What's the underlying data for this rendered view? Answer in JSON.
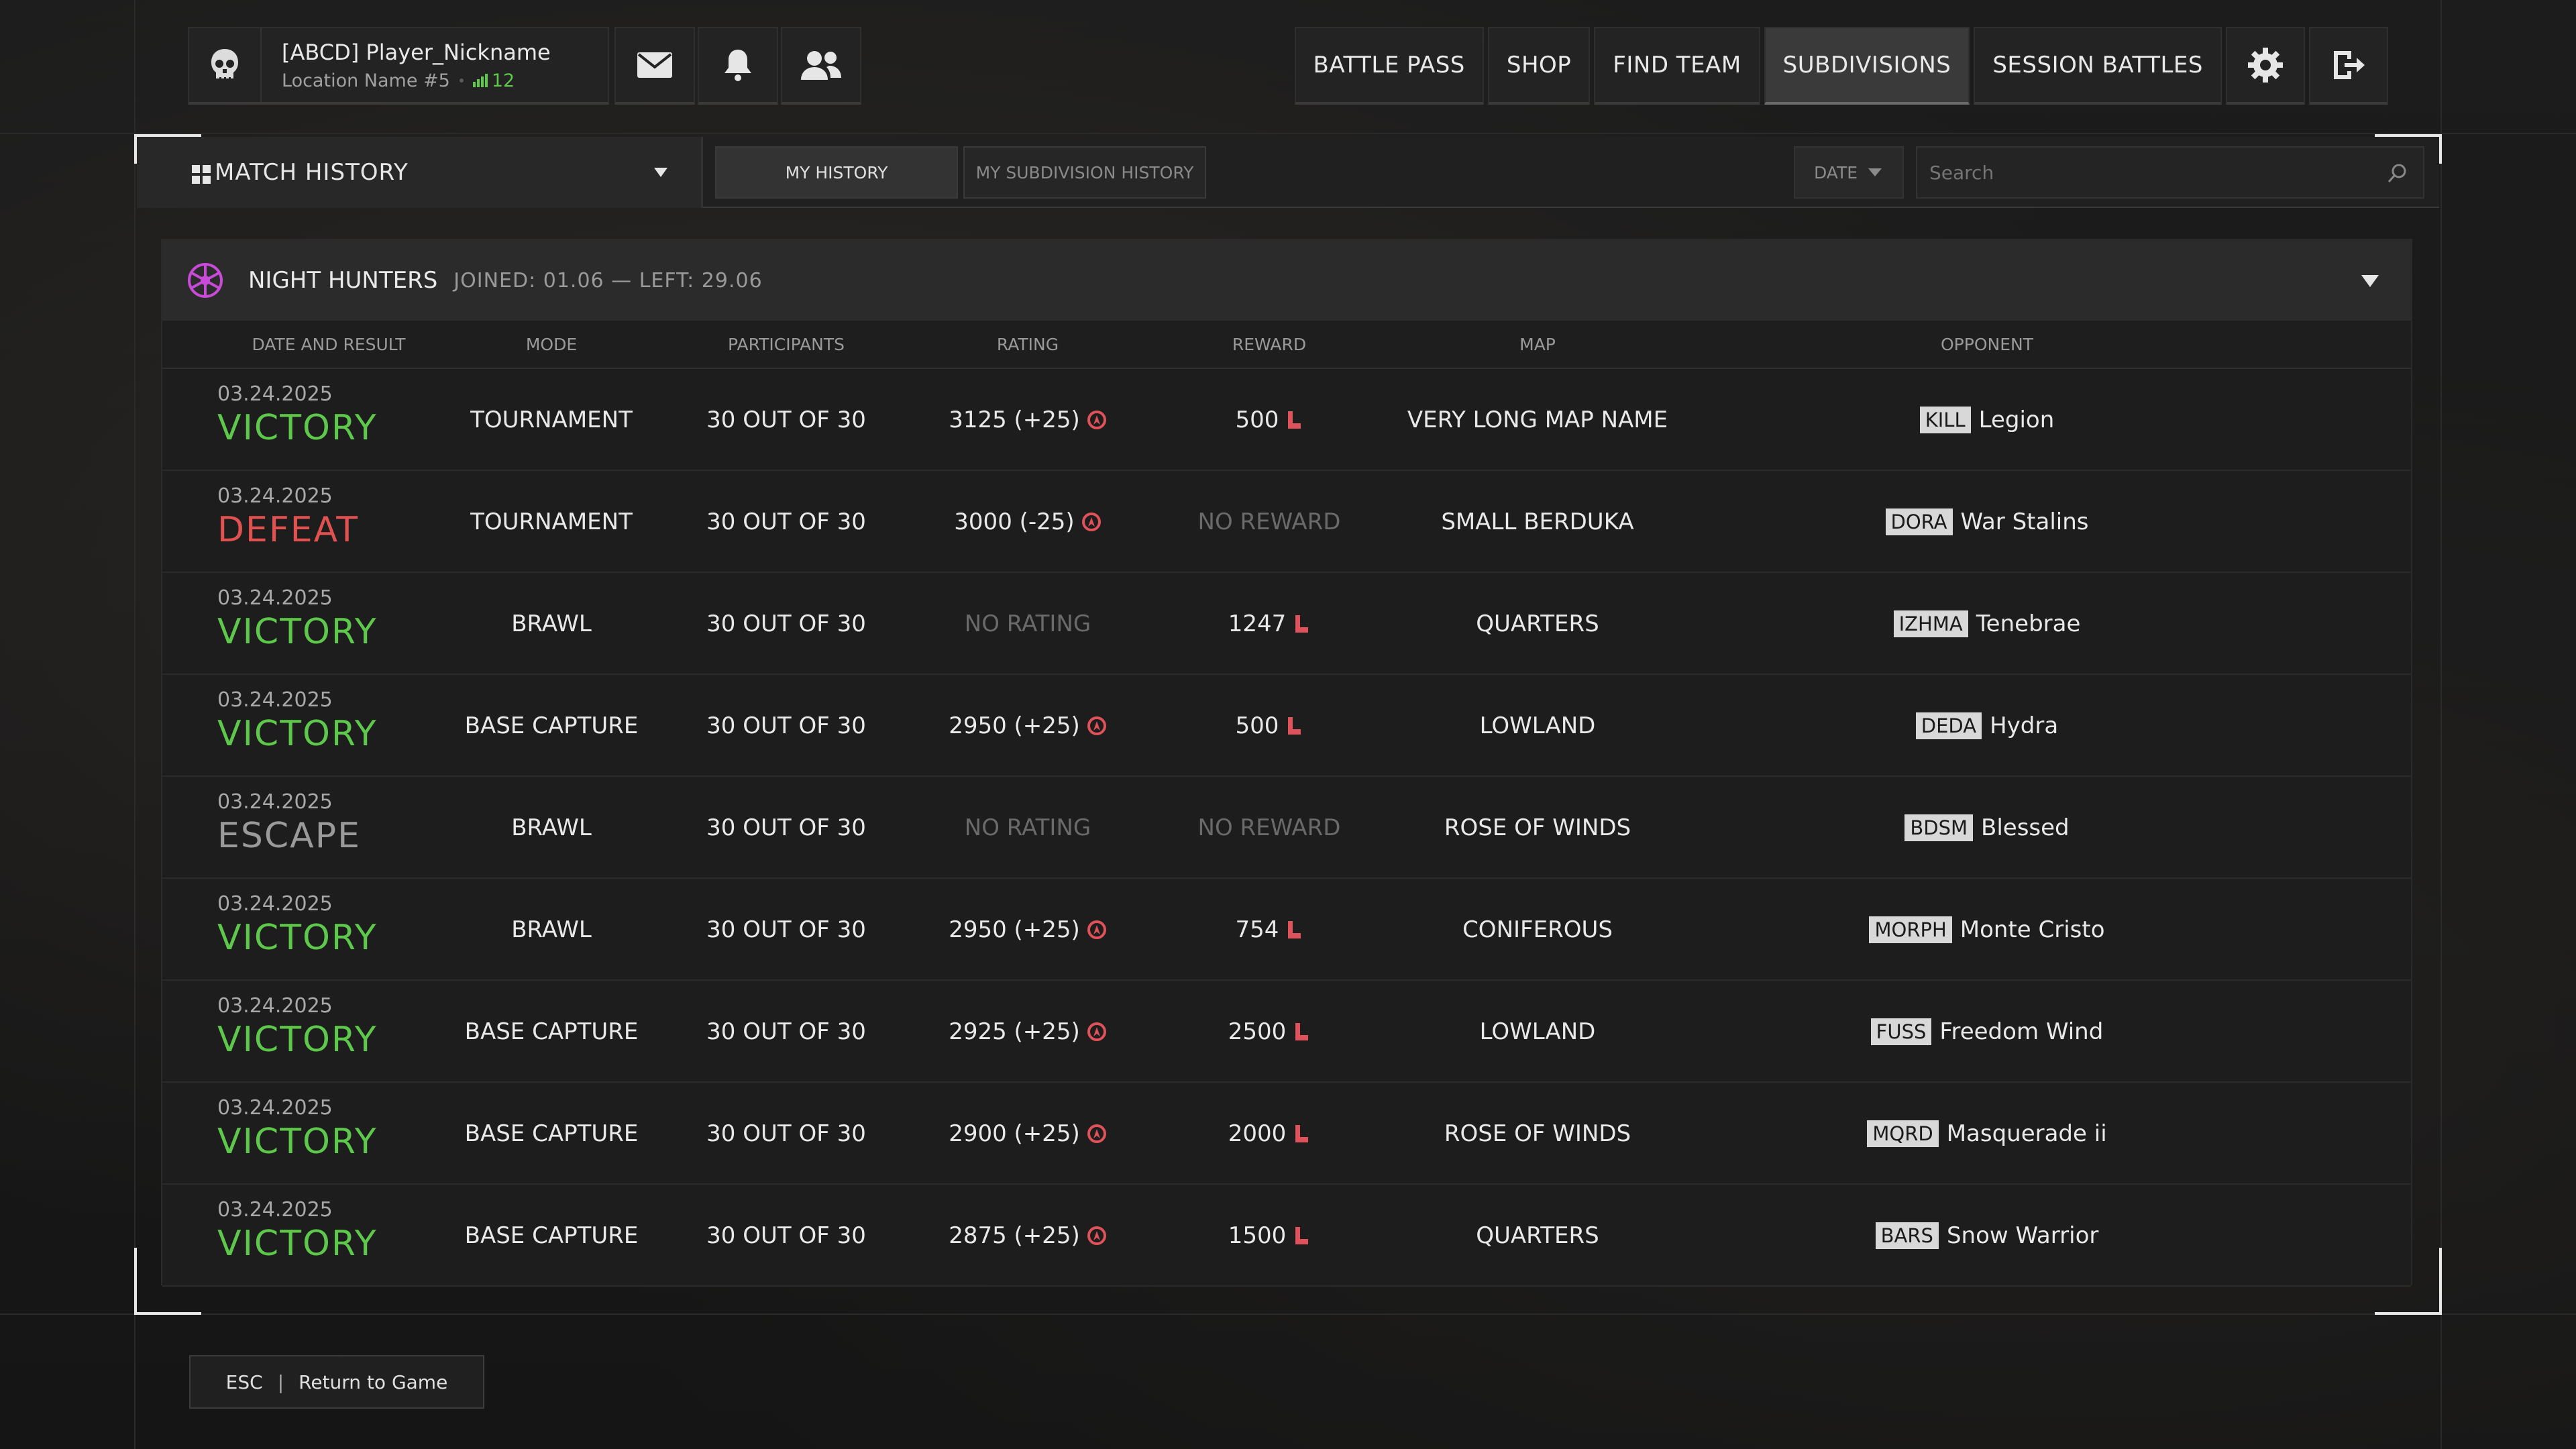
{
  "player": {
    "nickname": "[ABCD] Player_Nickname",
    "location": "Location Name #5",
    "level": "12"
  },
  "nav": {
    "battle_pass": "BATTLE PASS",
    "shop": "SHOP",
    "find_team": "FIND TEAM",
    "subdivisions": "SUBDIVISIONS",
    "session_battles": "SESSION BATTLES",
    "active": "SUBDIVISIONS"
  },
  "toolbar": {
    "title": "MATCH HISTORY",
    "tabs": [
      "MY HISTORY",
      "MY SUBDIVISION HISTORY"
    ],
    "active_tab": "MY HISTORY",
    "date_label": "DATE",
    "search_placeholder": "Search"
  },
  "subdivision": {
    "name": "NIGHT HUNTERS",
    "joined": "JOINED: 01.06 — LEFT: 29.06"
  },
  "columns": [
    "DATE AND RESULT",
    "MODE",
    "PARTICIPANTS",
    "RATING",
    "REWARD",
    "MAP",
    "OPPONENT"
  ],
  "rows": [
    {
      "date": "03.24.2025",
      "result": "VICTORY",
      "mode": "TOURNAMENT",
      "participants": "30 OUT OF 30",
      "rating": "3125 (+25)",
      "reward": "500",
      "map": "VERY LONG MAP NAME",
      "tag": "KILL",
      "opponent": "Legion"
    },
    {
      "date": "03.24.2025",
      "result": "DEFEAT",
      "mode": "TOURNAMENT",
      "participants": "30 OUT OF 30",
      "rating": "3000 (-25)",
      "reward": "NO REWARD",
      "map": "SMALL BERDUKA",
      "tag": "DORA",
      "opponent": "War Stalins"
    },
    {
      "date": "03.24.2025",
      "result": "VICTORY",
      "mode": "BRAWL",
      "participants": "30 OUT OF 30",
      "rating": "NO RATING",
      "reward": "1247",
      "map": "QUARTERS",
      "tag": "IZHMA",
      "opponent": "Tenebrae"
    },
    {
      "date": "03.24.2025",
      "result": "VICTORY",
      "mode": "BASE CAPTURE",
      "participants": "30 OUT OF 30",
      "rating": "2950 (+25)",
      "reward": "500",
      "map": "LOWLAND",
      "tag": "DEDA",
      "opponent": "Hydra"
    },
    {
      "date": "03.24.2025",
      "result": "ESCAPE",
      "mode": "BRAWL",
      "participants": "30 OUT OF 30",
      "rating": "NO RATING",
      "reward": "NO REWARD",
      "map": "ROSE OF WINDS",
      "tag": "BDSM",
      "opponent": "Blessed"
    },
    {
      "date": "03.24.2025",
      "result": "VICTORY",
      "mode": "BRAWL",
      "participants": "30 OUT OF 30",
      "rating": "2950 (+25)",
      "reward": "754",
      "map": "CONIFEROUS",
      "tag": "MORPH",
      "opponent": "Monte Cristo"
    },
    {
      "date": "03.24.2025",
      "result": "VICTORY",
      "mode": "BASE CAPTURE",
      "participants": "30 OUT OF 30",
      "rating": "2925 (+25)",
      "reward": "2500",
      "map": "LOWLAND",
      "tag": "FUSS",
      "opponent": "Freedom Wind"
    },
    {
      "date": "03.24.2025",
      "result": "VICTORY",
      "mode": "BASE CAPTURE",
      "participants": "30 OUT OF 30",
      "rating": "2900 (+25)",
      "reward": "2000",
      "map": "ROSE OF WINDS",
      "tag": "MQRD",
      "opponent": "Masquerade ii"
    },
    {
      "date": "03.24.2025",
      "result": "VICTORY",
      "mode": "BASE CAPTURE",
      "participants": "30 OUT OF 30",
      "rating": "2875 (+25)",
      "reward": "1500",
      "map": "QUARTERS",
      "tag": "BARS",
      "opponent": "Snow Warrior"
    }
  ],
  "footer": {
    "key": "ESC",
    "action": "Return to Game"
  },
  "colors": {
    "victory": "#5dc84b",
    "defeat": "#e0524f",
    "escape": "#9a9a9a",
    "level": "#5ec84a",
    "accent_icon": "#c84bd8",
    "currency": "#e0525a"
  },
  "icons": [
    "skull-avatar-icon",
    "mail-icon",
    "bell-icon",
    "friends-icon",
    "gear-icon",
    "exit-icon",
    "grid-icon",
    "search-icon",
    "subdivision-emblem-icon",
    "rating-icon",
    "currency-icon",
    "signal-icon"
  ]
}
